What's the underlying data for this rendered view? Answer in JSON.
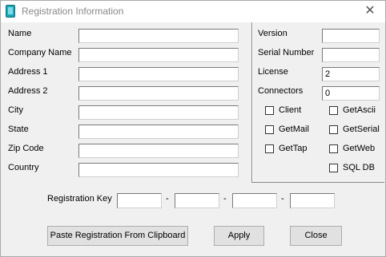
{
  "window": {
    "title": "Registration Information",
    "icon": "app-icon"
  },
  "left_form": {
    "fields": [
      {
        "label": "Name",
        "value": ""
      },
      {
        "label": "Company Name",
        "value": ""
      },
      {
        "label": "Address 1",
        "value": ""
      },
      {
        "label": "Address 2",
        "value": ""
      },
      {
        "label": "City",
        "value": ""
      },
      {
        "label": "State",
        "value": ""
      },
      {
        "label": "Zip Code",
        "value": ""
      },
      {
        "label": "Country",
        "value": ""
      }
    ]
  },
  "right_panel": {
    "fields": [
      {
        "label": "Version",
        "value": ""
      },
      {
        "label": "Serial Number",
        "value": ""
      },
      {
        "label": "License",
        "value": "2"
      },
      {
        "label": "Connectors",
        "value": "0"
      }
    ],
    "checkboxes": [
      {
        "label": "Client",
        "checked": false
      },
      {
        "label": "GetAscii",
        "checked": false
      },
      {
        "label": "GetMail",
        "checked": false
      },
      {
        "label": "GetSerial",
        "checked": false
      },
      {
        "label": "GetTap",
        "checked": false
      },
      {
        "label": "GetWeb",
        "checked": false
      },
      {
        "label": "SQL DB",
        "checked": false
      }
    ]
  },
  "registration_key": {
    "label": "Registration Key",
    "separator": "-",
    "parts": [
      "",
      "",
      "",
      ""
    ]
  },
  "buttons": {
    "paste": "Paste Registration From Clipboard",
    "apply": "Apply",
    "close": "Close"
  }
}
